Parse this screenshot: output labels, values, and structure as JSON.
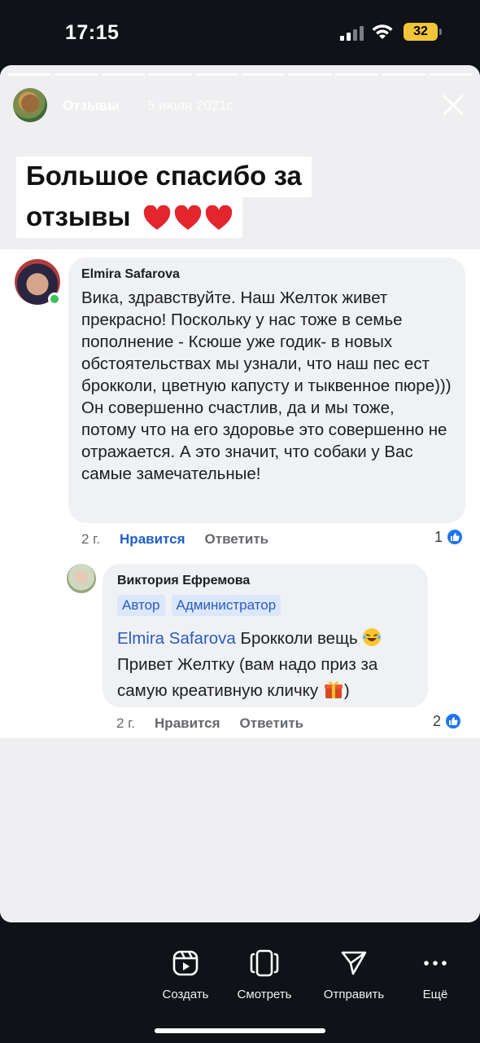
{
  "status_bar": {
    "time": "17:15",
    "battery": "32"
  },
  "story": {
    "progress_segments_total": 10,
    "progress_segments_done": 1,
    "author": "Отзывы",
    "date": "5 июля 2021г.",
    "headline_line1": "Большое спасибо за",
    "headline_line2": "отзывы",
    "heart_count": 3
  },
  "comment1": {
    "author": "Elmira Safarova",
    "text": "Вика, здравствуйте. Наш Желток живет прекрасно! Поскольку у нас тоже в семье пополнение - Ксюше уже годик- в новых обстоятельствах мы узнали, что наш пес ест брокколи, цветную капусту и тыквенное пюре))) Он совершенно счастлив, да и мы тоже, потому что на его здоровье это совершенно не отражается. А это значит, что собаки у Вас самые замечательные!",
    "time": "2 г.",
    "like_label": "Нравится",
    "reply_label": "Ответить",
    "likes": "1"
  },
  "comment2": {
    "author": "Виктория Ефремова",
    "badge_author": "Автор",
    "badge_admin": "Администратор",
    "mention": "Elmira Safarova",
    "text_part1": " Брокколи вещь ",
    "text_part2": " Привет Желтку (вам надо приз за самую креативную кличку ",
    "text_part3": ")",
    "time": "2 г.",
    "like_label": "Нравится",
    "reply_label": "Ответить",
    "likes": "2"
  },
  "action_bar": {
    "create": "Создать",
    "watch": "Смотреть",
    "send": "Отправить",
    "more": "Ещё"
  },
  "colors": {
    "background": "#0f1216",
    "card": "#efeff1",
    "bubble": "#f0f1f4",
    "link": "#1f5fc8",
    "like_badge": "#1d74f2",
    "online": "#37c35a",
    "battery": "#f2c43a"
  }
}
